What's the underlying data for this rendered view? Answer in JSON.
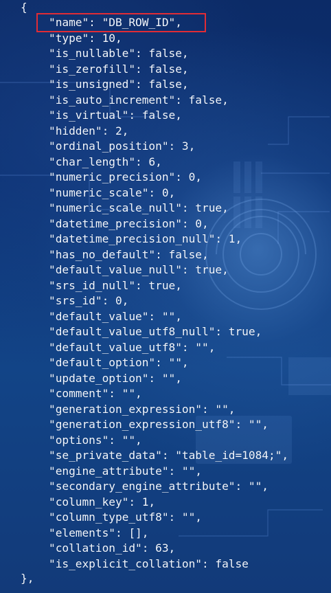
{
  "json_viewer": {
    "open_brace": "{",
    "close_brace": "},",
    "lines": [
      "\"name\": \"DB_ROW_ID\",",
      "\"type\": 10,",
      "\"is_nullable\": false,",
      "\"is_zerofill\": false,",
      "\"is_unsigned\": false,",
      "\"is_auto_increment\": false,",
      "\"is_virtual\": false,",
      "\"hidden\": 2,",
      "\"ordinal_position\": 3,",
      "\"char_length\": 6,",
      "\"numeric_precision\": 0,",
      "\"numeric_scale\": 0,",
      "\"numeric_scale_null\": true,",
      "\"datetime_precision\": 0,",
      "\"datetime_precision_null\": 1,",
      "\"has_no_default\": false,",
      "\"default_value_null\": true,",
      "\"srs_id_null\": true,",
      "\"srs_id\": 0,",
      "\"default_value\": \"\",",
      "\"default_value_utf8_null\": true,",
      "\"default_value_utf8\": \"\",",
      "\"default_option\": \"\",",
      "\"update_option\": \"\",",
      "\"comment\": \"\",",
      "\"generation_expression\": \"\",",
      "\"generation_expression_utf8\": \"\",",
      "\"options\": \"\",",
      "\"se_private_data\": \"table_id=1084;\",",
      "\"engine_attribute\": \"\",",
      "\"secondary_engine_attribute\": \"\",",
      "\"column_key\": 1,",
      "\"column_type_utf8\": \"\",",
      "\"elements\": [],",
      "\"collation_id\": 63,",
      "\"is_explicit_collation\": false"
    ]
  },
  "colors": {
    "highlight_border": "#e12c35",
    "text": "#f2f7ff"
  }
}
